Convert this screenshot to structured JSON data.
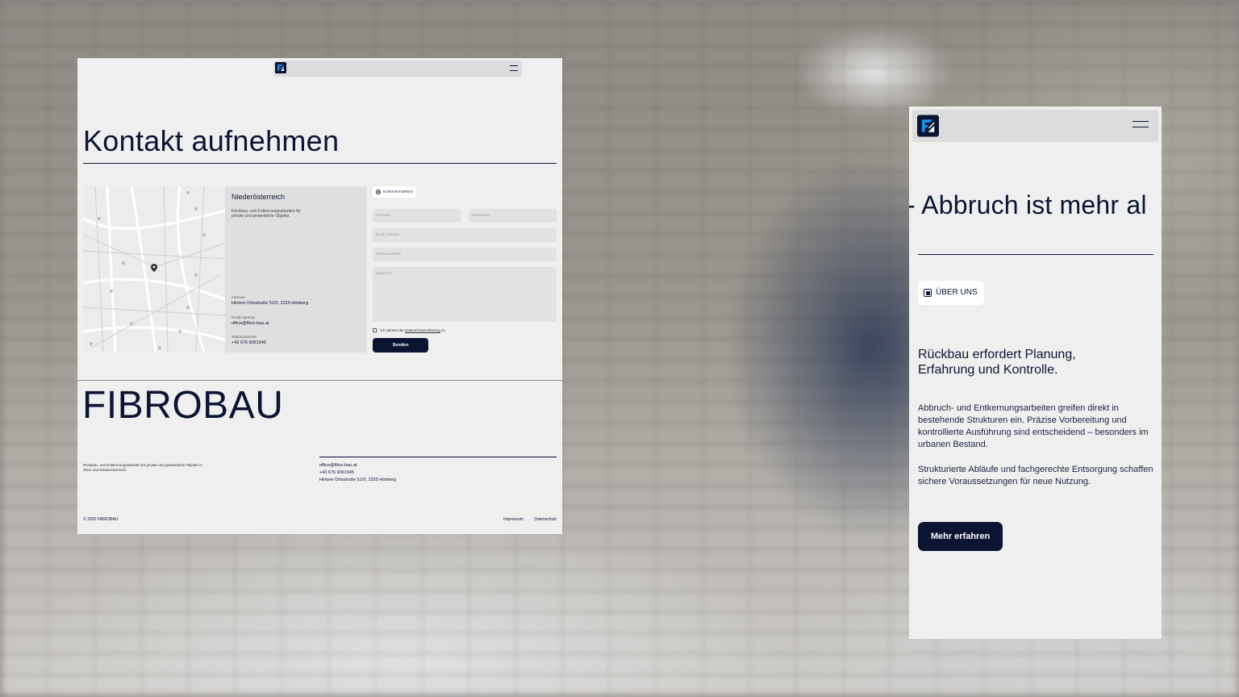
{
  "desktop": {
    "logo": "fibrobau-logo-icon",
    "menu_icon": "hamburger-menu-icon",
    "title": "Kontakt aufnehmen",
    "map_icon": "map-pin-icon",
    "card": {
      "region": "Niederösterreich",
      "description": "Rückbau- und Entkernungsarbeiten für private und gewerbliche Objekte.",
      "address_label": "Adresse",
      "address_value": "Hintere Ortsstraße 51/0, 2325 Himberg",
      "email_label": "Email-Adresse",
      "email_value": "office@fibro-bau.at",
      "phone_label": "Telefonnummer",
      "phone_value": "+43 676 9061945"
    },
    "form": {
      "badge": "KONTAKTIEREN",
      "firstname_placeholder": "Vorname",
      "lastname_placeholder": "Nachname",
      "email_placeholder": "Email Adresse",
      "phone_placeholder": "Telefonnummer",
      "message_placeholder": "Nachricht",
      "consent_prefix": "Ich stimme der",
      "consent_link": "Datenschutzerklärung",
      "consent_suffix": "zu",
      "submit": "Senden"
    },
    "footer": {
      "brand": "FIBROBAU",
      "description": "Rückbau- und Entkernungsarbeiten für private und gewerbliche Objekte in Wien und Niederösterreich.",
      "email": "office@fibro-bau.at",
      "phone": "+43 676 9061945",
      "address": "Hintere Ortsstraße 51/0, 2325 Himberg",
      "copyright": "© 2026 FIBROBAU",
      "links": [
        "Impressum",
        "Datenschutz"
      ]
    }
  },
  "mobile": {
    "logo": "fibrobau-logo-icon",
    "menu_icon": "hamburger-menu-icon",
    "marquee": "- Abbruch ist mehr al",
    "badge": "ÜBER UNS",
    "heading": "Rückbau erfordert Planung, Erfahrung und Kontrolle.",
    "paragraph1": "Abbruch- und Entkernungsarbeiten greifen direkt in bestehende Strukturen ein. Präzise Vorbereitung und kontrollierte Ausführung sind entscheidend – besonders im urbanen Bestand.",
    "paragraph2": "Strukturierte Abläufe und fachgerechte Entsorgung schaffen sichere Voraussetzungen für neue Nutzung.",
    "cta": "Mehr erfahren"
  },
  "colors": {
    "navy": "#0b1533",
    "logo_blue": "#1d8fe0",
    "panel_bg": "#efefef",
    "card_bg": "#dfdfdf"
  }
}
